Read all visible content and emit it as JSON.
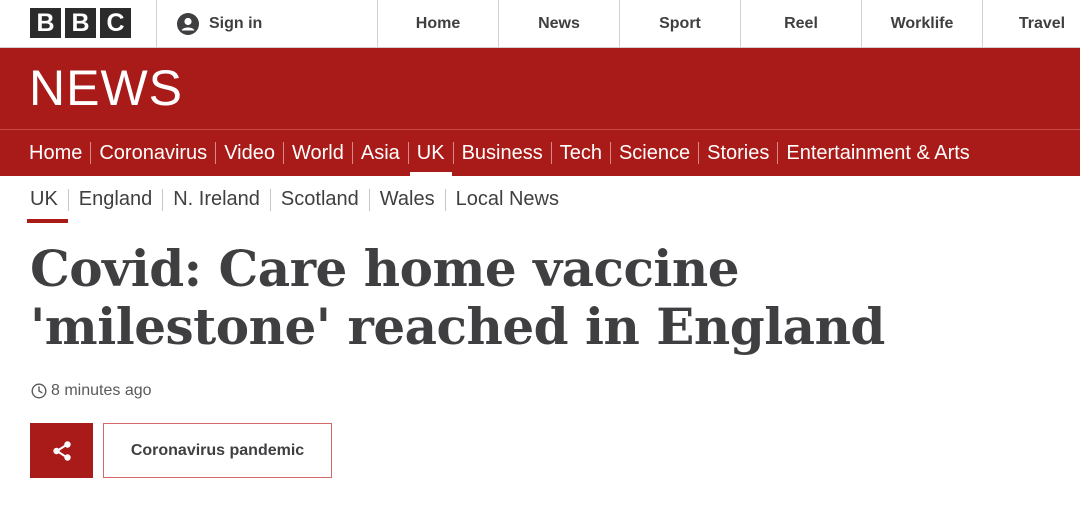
{
  "brand": {
    "letters": [
      "B",
      "B",
      "C"
    ]
  },
  "topbar": {
    "signin_label": "Sign in",
    "nav": [
      "Home",
      "News",
      "Sport",
      "Reel",
      "Worklife",
      "Travel"
    ]
  },
  "banner": {
    "title": "NEWS"
  },
  "primary_nav": [
    "Home",
    "Coronavirus",
    "Video",
    "World",
    "Asia",
    "UK",
    "Business",
    "Tech",
    "Science",
    "Stories",
    "Entertainment & Arts"
  ],
  "primary_nav_active": "UK",
  "secondary_nav": [
    "UK",
    "England",
    "N. Ireland",
    "Scotland",
    "Wales",
    "Local News"
  ],
  "secondary_nav_active": "UK",
  "article": {
    "headline": "Covid: Care home vaccine 'milestone' reached in England",
    "timestamp": "8 minutes ago",
    "tag_label": "Coronavirus pandemic"
  },
  "colors": {
    "brand_red": "#a91b18",
    "text_dark": "#3f3f42"
  },
  "icons": {
    "user": "user-icon",
    "clock": "clock-icon",
    "share": "share-icon"
  }
}
